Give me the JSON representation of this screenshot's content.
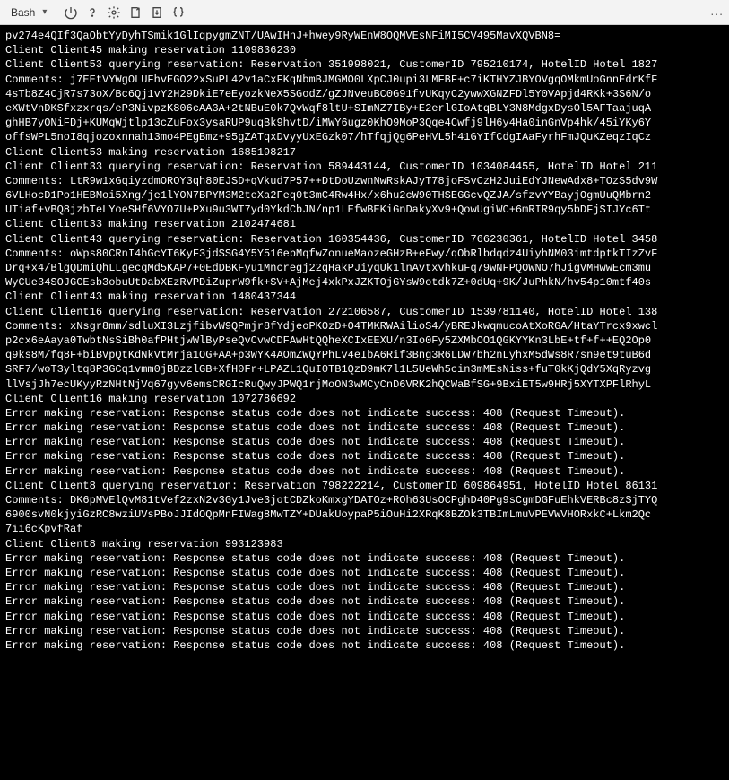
{
  "toolbar": {
    "shell_label": "Bash",
    "icons": {
      "power": "power-icon",
      "help": "help-icon",
      "gear": "gear-icon",
      "export": "export-icon",
      "download": "download-icon",
      "braces": "braces-icon",
      "overflow": "..."
    }
  },
  "terminal_lines": [
    "pv274e4QIf3QaObtYyDyhTSmik1GlIqpygmZNT/UAwIHnJ+hwey9RyWEnW8OQMVEsNFiMI5CV495MavXQVBN8=",
    "Client Client45 making reservation 1109836230",
    "Client Client53 querying reservation: Reservation 351998021, CustomerID 795210174, HotelID Hotel 1827",
    "Comments: j7EEtVYWgOLUFhvEGO22xSuPL42v1aCxFKqNbmBJMGMO0LXpCJ0upi3LMFBF+c7iKTHYZJBYOVgqOMkmUoGnnEdrKfF",
    "4sTb8Z4CjR7s73oX/Bc6Qj1vY2H29DkiE7eEyozkNeX5SGodZ/gZJNveuBC0G91fvUKqyC2ywwXGNZFDl5Y0VApjd4RKk+3S6N/o",
    "eXWtVnDKSfxzxrqs/eP3NivpzK806cAA3A+2tNBuE0k7QvWqf8ltU+SImNZ7IBy+E2erlGIoAtqBLY3N8MdgxDysOl5AFTaajuqA",
    "ghHB7yONiFDj+KUMqWjtlp13cZuFox3ysaRUP9uqBk9hvtD/iMWY6ugz0KhO9MoP3Qqe4Cwfj9lH6y4Ha0inGnVp4hk/45iYKy6Y",
    "offsWPL5noI8qjozoxnnah13mo4PEgBmz+95gZATqxDvyyUxEGzk07/hTfqjQg6PeHVL5h41GYIfCdgIAaFyrhFmJQuKZeqzIqCz",
    "Client Client53 making reservation 1685198217",
    "Client Client33 querying reservation: Reservation 589443144, CustomerID 1034084455, HotelID Hotel 211",
    "Comments: LtR9w1xGqiyzdmOROY3qh80EJSD+qVkud7P57++DtDoUzwnNwRskAJyT78joFSvCzH2JuiEdYJNewAdx8+TOzS5dv9W",
    "6VLHocD1Po1HEBMoi5Xng/je1lYON7BPYM3M2teXa2Feq0t3mC4Rw4Hx/x6hu2cW90THSEGGcvQZJA/sfzvYYBayjOgmUuQMbrn2",
    "UTiaf+vBQ8jzbTeLYoeSHf6VYO7U+PXu9u3WT7yd0YkdCbJN/np1LEfwBEKiGnDakyXv9+QowUgiWC+6mRIR9qy5bDFjSIJYc6Tt",
    "Client Client33 making reservation 2102474681",
    "Client Client43 querying reservation: Reservation 160354436, CustomerID 766230361, HotelID Hotel 3458",
    "Comments: oWps80CRnI4hGcYT6KyF3jdSSG4Y5Y516ebMqfwZonueMaozeGHzB+eFwy/qObRlbdqdz4UiyhNM03imtdptkTIzZvF",
    "Drq+x4/BlgQDmiQhLLgecqMd5KAP7+0EdDBKFyu1Mncregj22qHakPJiyqUk1lnAvtxvhkuFq79wNFPQOWNO7hJigVMHwwEcm3mu",
    "WyCUe34SOJGCEsb3obuUtDabXEzRVPDiZuprW9fk+SV+AjMej4xkPxJZKTOjGYsW9otdk7Z+0dUq+9K/JuPhkN/hv54p10mtf40s",
    "Client Client43 making reservation 1480437344",
    "Client Client16 querying reservation: Reservation 272106587, CustomerID 1539781140, HotelID Hotel 138",
    "Comments: xNsgr8mm/sdluXI3LzjfibvW9QPmjr8fYdjeoPKOzD+O4TMKRWAilioS4/yBREJkwqmucoAtXoRGA/HtaYTrcx9xwcl",
    "p2cx6eAaya0TwbtNsSiBh0afPHtjwWlByPseQvCvwCDFAwHtQQheXCIxEEXU/n3Io0Fy5ZXMbOO1QGKYYKn3LbE+tf+f++EQ2Op0",
    "q9ks8M/fq8F+biBVpQtKdNkVtMrja1OG+AA+p3WYK4AOmZWQYPhLv4eIbA6Rif3Bng3R6LDW7bh2nLyhxM5dWs8R7sn9et9tuB6d",
    "SRF7/woT3yltq8P3GCq1vmm0jBDzzlGB+XfH0Fr+LPAZL1QuI0TB1QzD9mK7l1L5UeWh5cin3mMEsNiss+fuT0kKjQdY5XqRyzvg",
    "llVsjJh7ecUKyyRzNHtNjVq67gyv6emsCRGIcRuQwyJPWQ1rjMoON3wMCyCnD6VRK2hQCWaBfSG+9BxiET5w9HRj5XYTXPFlRhyL",
    "Client Client16 making reservation 1072786692",
    "Error making reservation: Response status code does not indicate success: 408 (Request Timeout).",
    "Error making reservation: Response status code does not indicate success: 408 (Request Timeout).",
    "Error making reservation: Response status code does not indicate success: 408 (Request Timeout).",
    "Error making reservation: Response status code does not indicate success: 408 (Request Timeout).",
    "Error making reservation: Response status code does not indicate success: 408 (Request Timeout).",
    "Client Client8 querying reservation: Reservation 798222214, CustomerID 609864951, HotelID Hotel 86131",
    "Comments: DK6pMVElQvM81tVef2zxN2v3Gy1Jve3jotCDZkoKmxgYDATOz+ROh63UsOCPghD40Pg9sCgmDGFuEhkVERBc8zSjTYQ",
    "6900svN0kjyiGzRC8wziUVsPBoJJIdOQpMnFIWag8MwTZY+DUakUoypaP5iOuHi2XRqK8BZOk3TBImLmuVPEVWVHORxkC+Lkm2Qc",
    "7ii6cKpvfRaf",
    "Client Client8 making reservation 993123983",
    "Error making reservation: Response status code does not indicate success: 408 (Request Timeout).",
    "Error making reservation: Response status code does not indicate success: 408 (Request Timeout).",
    "Error making reservation: Response status code does not indicate success: 408 (Request Timeout).",
    "Error making reservation: Response status code does not indicate success: 408 (Request Timeout).",
    "Error making reservation: Response status code does not indicate success: 408 (Request Timeout).",
    "Error making reservation: Response status code does not indicate success: 408 (Request Timeout).",
    "Error making reservation: Response status code does not indicate success: 408 (Request Timeout)."
  ]
}
